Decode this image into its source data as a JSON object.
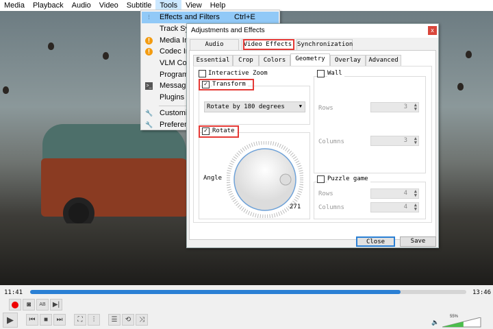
{
  "menubar": {
    "items": [
      "Media",
      "Playback",
      "Audio",
      "Video",
      "Subtitle",
      "Tools",
      "View",
      "Help"
    ]
  },
  "tools_menu": {
    "items": [
      {
        "label": "Effects and Filters",
        "shortcut": "Ctrl+E",
        "icon": "equalizer-icon"
      },
      {
        "label": "Track Sync",
        "icon": ""
      },
      {
        "label": "Media Info",
        "icon": "info-icon"
      },
      {
        "label": "Codec Info",
        "icon": "info-icon"
      },
      {
        "label": "VLM Conf",
        "icon": ""
      },
      {
        "label": "Program G",
        "icon": ""
      },
      {
        "label": "Messages",
        "icon": "terminal-icon"
      },
      {
        "label": "Plugins an",
        "icon": ""
      },
      {
        "label": "Customize",
        "icon": "wrench-icon"
      },
      {
        "label": "Preferences",
        "icon": "wrench-icon"
      }
    ]
  },
  "dialog": {
    "title": "Adjustments and Effects",
    "close": "x",
    "tabs": [
      "Audio Effects",
      "Video Effects",
      "Synchronization"
    ],
    "subtabs": [
      "Essential",
      "Crop",
      "Colors",
      "Geometry",
      "Overlay",
      "Advanced"
    ],
    "interactive_zoom": "Interactive Zoom",
    "transform": "Transform",
    "transform_value": "Rotate by 180 degrees",
    "rotate": "Rotate",
    "angle_label": "Angle",
    "angle_value": "271",
    "wall": "Wall",
    "wall_rows_label": "Rows",
    "wall_rows": "3",
    "wall_cols_label": "Columns",
    "wall_cols": "3",
    "puzzle": "Puzzle game",
    "puzzle_rows_label": "Rows",
    "puzzle_rows": "4",
    "puzzle_cols_label": "Columns",
    "puzzle_cols": "4",
    "close_btn": "Close",
    "save_btn": "Save"
  },
  "player": {
    "elapsed": "11:41",
    "total": "13:46",
    "progress": 0.85,
    "volume": "55%",
    "volume_level": 0.55,
    "accent": "#2a7fd4"
  }
}
